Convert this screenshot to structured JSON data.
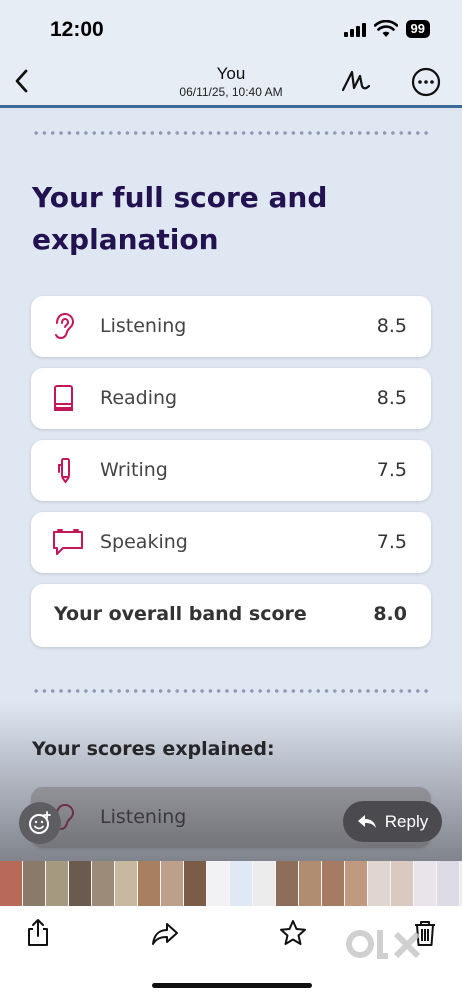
{
  "status": {
    "time": "12:00",
    "battery": "99"
  },
  "header": {
    "title": "You",
    "subtitle": "06/11/25, 10:40 AM"
  },
  "message": {
    "headline_line1": "Your full score and",
    "headline_line2": "explanation",
    "scores": [
      {
        "label": "Listening",
        "score": "8.5",
        "icon": "ear-icon"
      },
      {
        "label": "Reading",
        "score": "8.5",
        "icon": "book-icon"
      },
      {
        "label": "Writing",
        "score": "7.5",
        "icon": "pencil-icon"
      },
      {
        "label": "Speaking",
        "score": "7.5",
        "icon": "speech-bubble-icon"
      }
    ],
    "overall": {
      "label": "Your overall band score",
      "score": "8.0"
    },
    "explained_heading": "Your scores explained:",
    "explained_first": {
      "label": "Listening",
      "icon": "ear-icon"
    }
  },
  "actions": {
    "reply_label": "Reply"
  },
  "colors": {
    "accent": "#c2185b",
    "heading": "#22124f",
    "nav_border": "#3c6a99"
  }
}
